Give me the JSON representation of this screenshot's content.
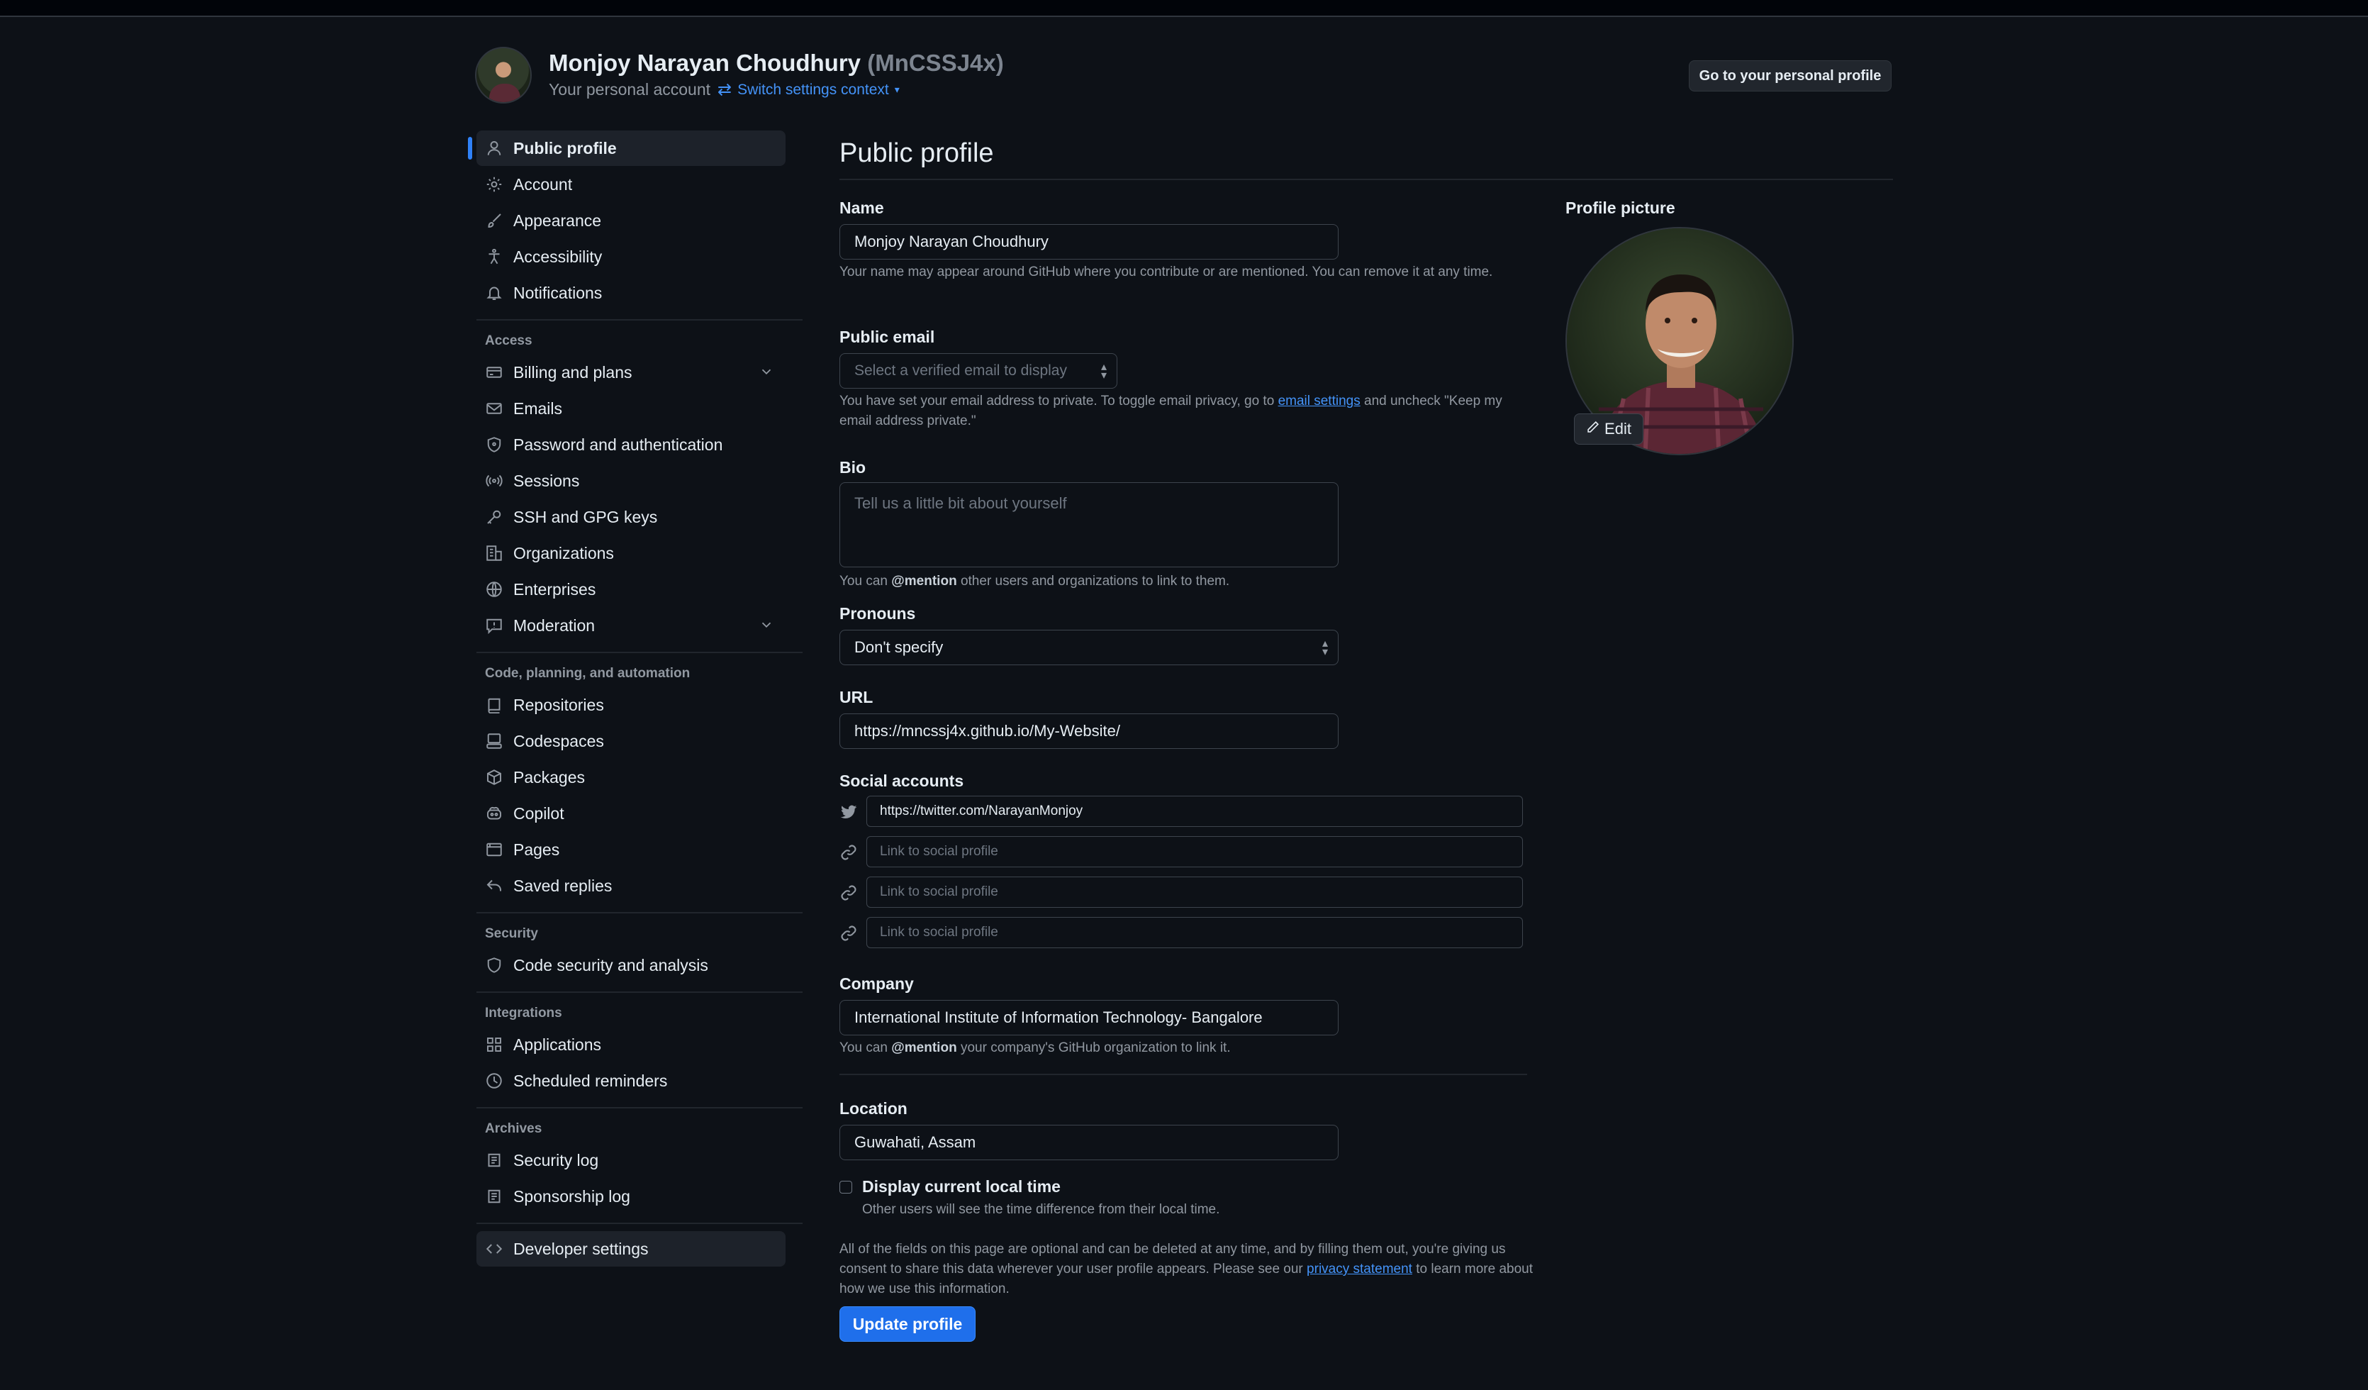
{
  "header": {
    "name": "Monjoy Narayan Choudhury",
    "login": "(MnCSSJ4x)",
    "subtitle": "Your personal account",
    "switch_label": "Switch settings context",
    "personal_profile_btn": "Go to your personal profile"
  },
  "sidebar": {
    "items": [
      {
        "label": "Public profile",
        "icon": "person-icon",
        "active": true
      },
      {
        "label": "Account",
        "icon": "gear-icon"
      },
      {
        "label": "Appearance",
        "icon": "paintbrush-icon"
      },
      {
        "label": "Accessibility",
        "icon": "accessibility-icon"
      },
      {
        "label": "Notifications",
        "icon": "bell-icon"
      }
    ],
    "access_heading": "Access",
    "access_items": [
      {
        "label": "Billing and plans",
        "icon": "credit-card-icon",
        "expandable": true
      },
      {
        "label": "Emails",
        "icon": "mail-icon"
      },
      {
        "label": "Password and authentication",
        "icon": "shield-lock-icon"
      },
      {
        "label": "Sessions",
        "icon": "broadcast-icon"
      },
      {
        "label": "SSH and GPG keys",
        "icon": "key-icon"
      },
      {
        "label": "Organizations",
        "icon": "organization-icon"
      },
      {
        "label": "Enterprises",
        "icon": "globe-icon"
      },
      {
        "label": "Moderation",
        "icon": "report-icon",
        "expandable": true
      }
    ],
    "code_heading": "Code, planning, and automation",
    "code_items": [
      {
        "label": "Repositories",
        "icon": "repo-icon"
      },
      {
        "label": "Codespaces",
        "icon": "codespaces-icon"
      },
      {
        "label": "Packages",
        "icon": "package-icon"
      },
      {
        "label": "Copilot",
        "icon": "copilot-icon"
      },
      {
        "label": "Pages",
        "icon": "browser-icon"
      },
      {
        "label": "Saved replies",
        "icon": "reply-icon"
      }
    ],
    "security_heading": "Security",
    "security_items": [
      {
        "label": "Code security and analysis",
        "icon": "shield-icon"
      }
    ],
    "integrations_heading": "Integrations",
    "integrations_items": [
      {
        "label": "Applications",
        "icon": "apps-icon"
      },
      {
        "label": "Scheduled reminders",
        "icon": "clock-icon"
      }
    ],
    "archives_heading": "Archives",
    "archives_items": [
      {
        "label": "Security log",
        "icon": "log-icon"
      },
      {
        "label": "Sponsorship log",
        "icon": "log-icon"
      }
    ],
    "developer_settings": "Developer settings"
  },
  "main": {
    "title": "Public profile",
    "name_label": "Name",
    "name_value": "Monjoy Narayan Choudhury",
    "name_note": "Your name may appear around GitHub where you contribute or are mentioned. You can remove it at any time.",
    "email_label": "Public email",
    "email_placeholder": "Select a verified email to display",
    "email_note_1": "You have set your email address to private. To toggle email privacy, go to ",
    "email_note_link": "email settings",
    "email_note_2": " and uncheck \"Keep my email address private.\"",
    "bio_label": "Bio",
    "bio_placeholder": "Tell us a little bit about yourself",
    "bio_note_1": "You can ",
    "bio_note_mention": "@mention",
    "bio_note_2": " other users and organizations to link to them.",
    "pronouns_label": "Pronouns",
    "pronouns_value": "Don't specify",
    "url_label": "URL",
    "url_value": "https://mncssj4x.github.io/My-Website/",
    "social_label": "Social accounts",
    "social": [
      {
        "value": "https://twitter.com/NarayanMonjoy",
        "icon": "twitter-icon"
      },
      {
        "placeholder": "Link to social profile",
        "icon": "link-icon"
      },
      {
        "placeholder": "Link to social profile",
        "icon": "link-icon"
      },
      {
        "placeholder": "Link to social profile",
        "icon": "link-icon"
      }
    ],
    "company_label": "Company",
    "company_value": "International Institute of Information Technology- Bangalore",
    "company_note_1": "You can ",
    "company_note_mention": "@mention",
    "company_note_2": " your company's GitHub organization to link it.",
    "location_label": "Location",
    "location_value": "Guwahati, Assam",
    "localtime_label": "Display current local time",
    "localtime_note": "Other users will see the time difference from their local time.",
    "consent_1": "All of the fields on this page are optional and can be deleted at any time, and by filling them out, you're giving us consent to share this data wherever your user profile appears. Please see our ",
    "consent_link": "privacy statement",
    "consent_2": " to learn more about how we use this information.",
    "update_btn": "Update profile",
    "profile_picture_label": "Profile picture",
    "edit_btn": "Edit"
  },
  "colors": {
    "background": "#0d1117",
    "accent": "#1f6feb",
    "link": "#4493f8",
    "muted": "#9198a1"
  }
}
